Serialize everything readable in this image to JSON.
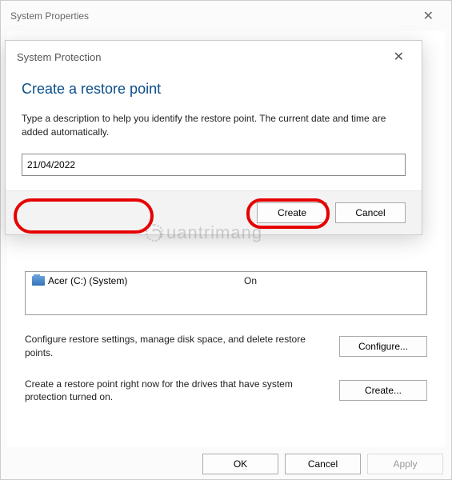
{
  "parent": {
    "title": "System Properties",
    "drives": [
      {
        "name": "Acer (C:) (System)",
        "status": "On"
      }
    ],
    "configure": {
      "text": "Configure restore settings, manage disk space, and delete restore points.",
      "button": "Configure..."
    },
    "create": {
      "text": "Create a restore point right now for the drives that have system protection turned on.",
      "button": "Create..."
    },
    "buttons": {
      "ok": "OK",
      "cancel": "Cancel",
      "apply": "Apply"
    }
  },
  "dialog": {
    "title": "System Protection",
    "heading": "Create a restore point",
    "description": "Type a description to help you identify the restore point. The current date and time are added automatically.",
    "input_value": "21/04/2022",
    "create_label": "Create",
    "cancel_label": "Cancel"
  },
  "watermark": "uantrimang"
}
